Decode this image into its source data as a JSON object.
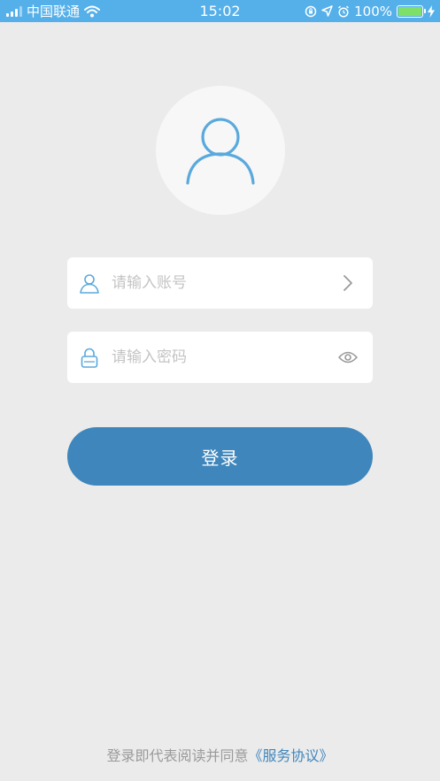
{
  "status_bar": {
    "carrier": "中国联通",
    "time": "15:02",
    "battery": "100%",
    "battery_level": 1.0
  },
  "login": {
    "account_placeholder": "请输入账号",
    "password_placeholder": "请输入密码",
    "submit_label": "登录"
  },
  "agreement": {
    "prefix": "登录即代表阅读并同意",
    "link_label": "《服务协议》"
  },
  "colors": {
    "status_bar": "#55b0ea",
    "background": "#ebebeb",
    "primary_button": "#3f86bc",
    "icon_accent": "#5aa9dd",
    "link": "#3f86bc"
  }
}
